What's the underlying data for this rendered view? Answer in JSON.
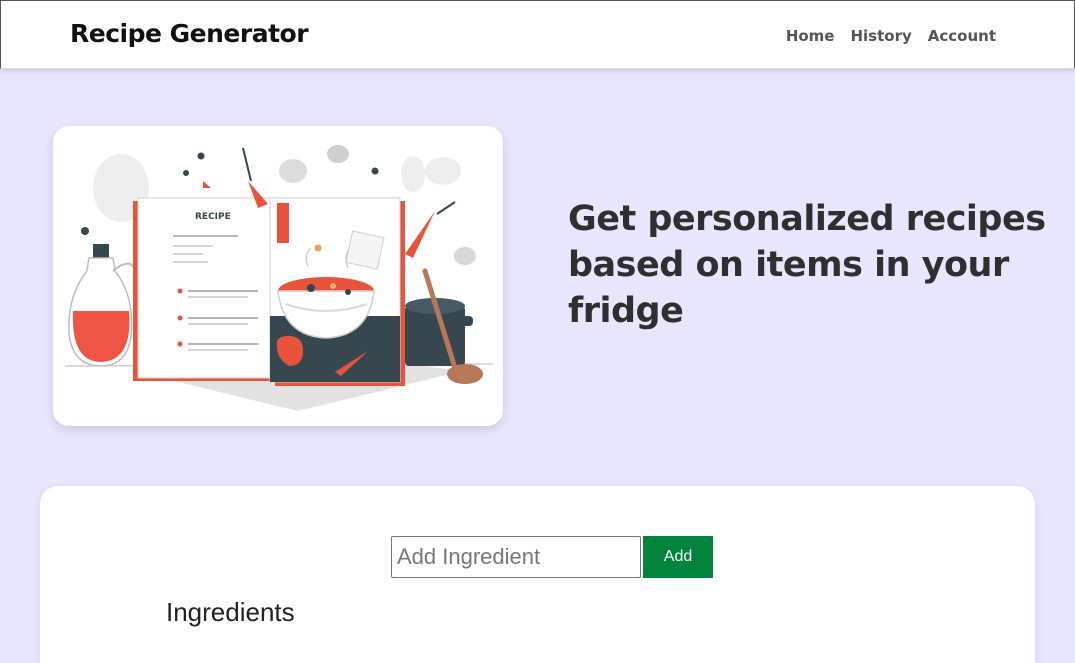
{
  "header": {
    "brand": "Recipe Generator",
    "nav": [
      {
        "label": "Home"
      },
      {
        "label": "History"
      },
      {
        "label": "Account"
      }
    ]
  },
  "hero": {
    "headline": "Get personalized recipes based on items in your fridge",
    "illustration": {
      "book_label": "RECIPE"
    }
  },
  "ingredient_form": {
    "input_placeholder": "Add Ingredient",
    "input_value": "",
    "add_label": "Add",
    "list_heading": "Ingredients"
  },
  "colors": {
    "background": "#e8e6fe",
    "accent_button": "#00843d",
    "illustration_red": "#e8533c",
    "illustration_dark": "#37474f"
  }
}
